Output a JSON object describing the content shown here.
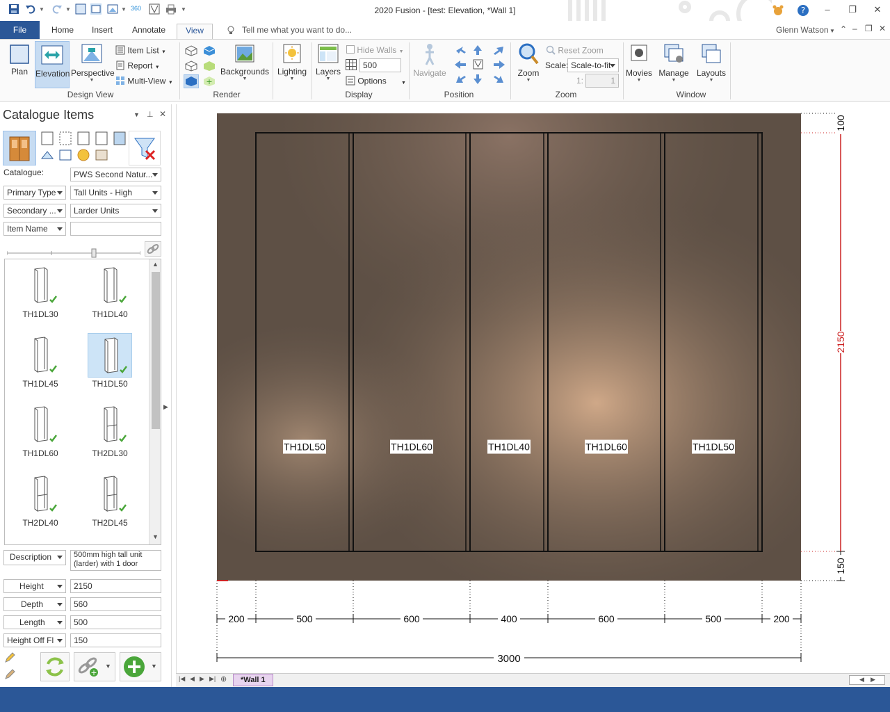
{
  "window": {
    "title": "2020 Fusion - [test: Elevation, *Wall 1]",
    "user": "Glenn Watson",
    "minimize": "–",
    "restore": "❐",
    "close": "✕"
  },
  "tabs": {
    "file": "File",
    "items": [
      "Home",
      "Insert",
      "Annotate",
      "View"
    ],
    "active": "View",
    "tell_me": "Tell me what you want to do..."
  },
  "ribbon": {
    "design_view": {
      "label": "Design View",
      "plan": "Plan",
      "elevation": "Elevation",
      "perspective": "Perspective",
      "item_list": "Item List",
      "report": "Report",
      "multi_view": "Multi-View"
    },
    "render": {
      "label": "Render",
      "backgrounds": "Backgrounds"
    },
    "lighting": "Lighting",
    "display": {
      "label": "Display",
      "layers": "Layers",
      "hide_walls": "Hide Walls",
      "grid_value": "500",
      "options": "Options"
    },
    "position": {
      "label": "Position",
      "navigate": "Navigate"
    },
    "zoom": {
      "label": "Zoom",
      "zoom": "Zoom",
      "reset_zoom": "Reset Zoom",
      "scale_label": "Scale:",
      "scale_value": "Scale-to-fit",
      "ratio_prefix": "1:",
      "ratio_value": "1"
    },
    "window": {
      "label": "Window",
      "movies": "Movies",
      "manage": "Manage",
      "layouts": "Layouts"
    }
  },
  "catalogue": {
    "title": "Catalogue Items",
    "catalogue_label": "Catalogue:",
    "catalogue_value": "PWS Second Natur...",
    "primary_type_label": "Primary Type",
    "primary_type_value": "Tall Units - High",
    "secondary_label": "Secondary ...",
    "secondary_value": "Larder Units",
    "item_name_label": "Item Name",
    "item_name_value": "",
    "items": [
      {
        "name": "TH1DL30",
        "selected": false
      },
      {
        "name": "TH1DL40",
        "selected": false
      },
      {
        "name": "TH1DL45",
        "selected": false
      },
      {
        "name": "TH1DL50",
        "selected": true
      },
      {
        "name": "TH1DL60",
        "selected": false
      },
      {
        "name": "TH2DL30",
        "selected": false
      },
      {
        "name": "TH2DL40",
        "selected": false
      },
      {
        "name": "TH2DL45",
        "selected": false
      }
    ],
    "properties": {
      "description_label": "Description",
      "description_value": "500mm high tall unit (larder) with 1 door",
      "height_label": "Height",
      "height_value": "2150",
      "depth_label": "Depth",
      "depth_value": "560",
      "length_label": "Length",
      "length_value": "500",
      "height_off_label": "Height Off Fl",
      "height_off_value": "150"
    }
  },
  "elevation": {
    "units": [
      {
        "label": "TH1DL50",
        "width": 500
      },
      {
        "label": "TH1DL60",
        "width": 600
      },
      {
        "label": "TH1DL40",
        "width": 400
      },
      {
        "label": "TH1DL60",
        "width": 600
      },
      {
        "label": "TH1DL50",
        "width": 500
      }
    ],
    "horizontal_dims": [
      "200",
      "500",
      "600",
      "400",
      "600",
      "500",
      "200"
    ],
    "total_width": "3000",
    "vertical_dims": [
      "100",
      "2150",
      "150"
    ]
  },
  "sheet_tab": "*Wall 1",
  "colors": {
    "accent": "#2b5797",
    "dimension_red": "#cc2222",
    "wall_bg": "#6b5a4c"
  }
}
